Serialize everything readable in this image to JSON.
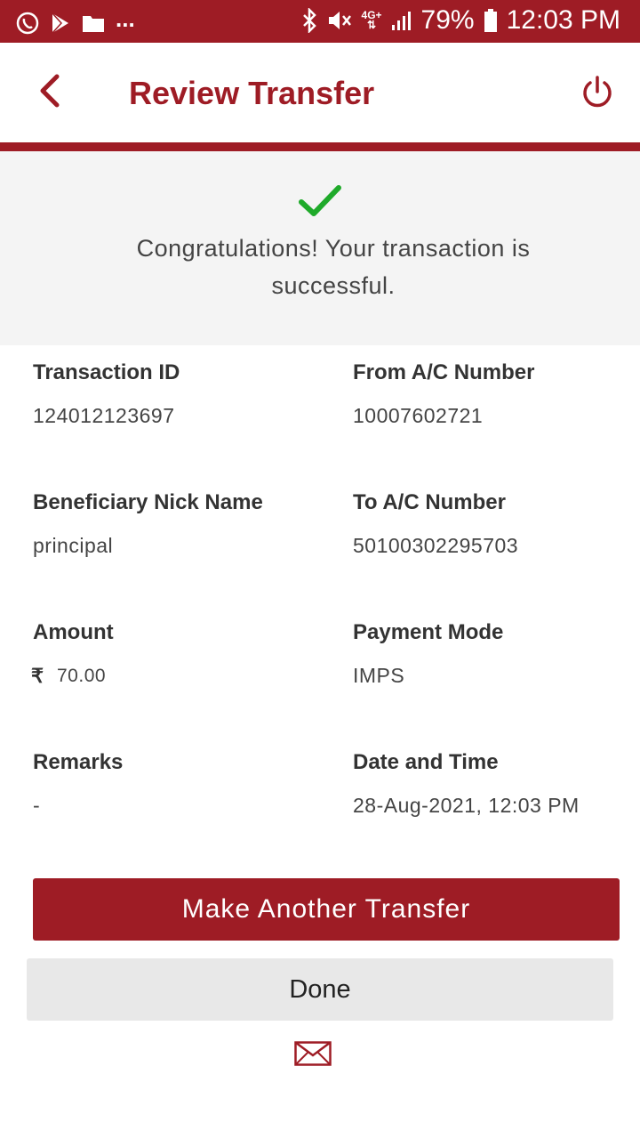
{
  "status_bar": {
    "icons": [
      "whatsapp-icon",
      "play-store-icon",
      "folder-icon",
      "more-dots"
    ],
    "dots": "...",
    "right_icons": [
      "bluetooth-icon",
      "mute-icon",
      "network-4g-icon",
      "signal-icon",
      "battery-icon"
    ],
    "network_type": "4G+",
    "battery": "79%",
    "time": "12:03 PM"
  },
  "header": {
    "title": "Review Transfer",
    "back_icon": "chevron-left-icon",
    "logout_icon": "power-icon"
  },
  "banner": {
    "icon": "checkmark-icon",
    "message": "Congratulations! Your transaction is successful."
  },
  "details": {
    "transaction_id_label": "Transaction ID",
    "transaction_id": "124012123697",
    "from_ac_label": "From A/C Number",
    "from_ac": "10007602721",
    "beneficiary_label": "Beneficiary Nick Name",
    "beneficiary": "principal",
    "to_ac_label": "To A/C Number",
    "to_ac": "50100302295703",
    "amount_label": "Amount",
    "currency_symbol": "₹",
    "amount": "70.00",
    "payment_mode_label": "Payment Mode",
    "payment_mode": "IMPS",
    "remarks_label": "Remarks",
    "remarks": "-",
    "datetime_label": "Date and Time",
    "datetime": "28-Aug-2021, 12:03 PM"
  },
  "actions": {
    "primary": "Make Another Transfer",
    "secondary": "Done",
    "mail_icon": "mail-icon"
  },
  "colors": {
    "brand": "#9e1c25",
    "success": "#1faa2a",
    "banner_bg": "#f4f4f4",
    "secondary_button": "#e8e8e8"
  }
}
